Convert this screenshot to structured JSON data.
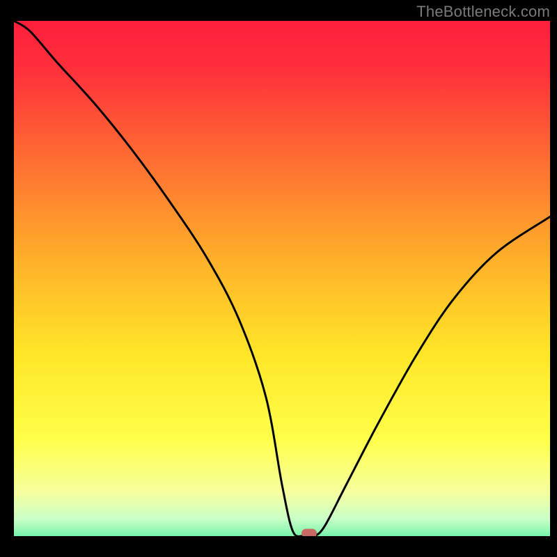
{
  "watermark": "TheBottleneck.com",
  "chart_data": {
    "type": "line",
    "title": "",
    "xlabel": "",
    "ylabel": "",
    "xlim": [
      0,
      100
    ],
    "ylim": [
      0,
      100
    ],
    "series": [
      {
        "name": "bottleneck-curve",
        "x": [
          0,
          3,
          8,
          15,
          22,
          29,
          36,
          42,
          47,
          50,
          52,
          54,
          56,
          58,
          62,
          68,
          75,
          82,
          90,
          100
        ],
        "values": [
          100,
          98,
          92,
          84,
          75,
          65,
          54,
          42,
          27,
          10,
          1,
          0,
          0,
          2,
          10,
          22,
          35,
          46,
          55,
          62
        ]
      }
    ],
    "marker": {
      "x": 55,
      "y": 0
    },
    "gradient_stops": [
      {
        "offset": 0.0,
        "color": "#ff1f3b"
      },
      {
        "offset": 0.1,
        "color": "#ff333b"
      },
      {
        "offset": 0.25,
        "color": "#ff6a32"
      },
      {
        "offset": 0.45,
        "color": "#ffb22a"
      },
      {
        "offset": 0.62,
        "color": "#ffe627"
      },
      {
        "offset": 0.78,
        "color": "#ffff4a"
      },
      {
        "offset": 0.88,
        "color": "#f6ffa0"
      },
      {
        "offset": 0.93,
        "color": "#c8ffc8"
      },
      {
        "offset": 0.965,
        "color": "#6df2a6"
      },
      {
        "offset": 1.0,
        "color": "#00d873"
      }
    ]
  }
}
